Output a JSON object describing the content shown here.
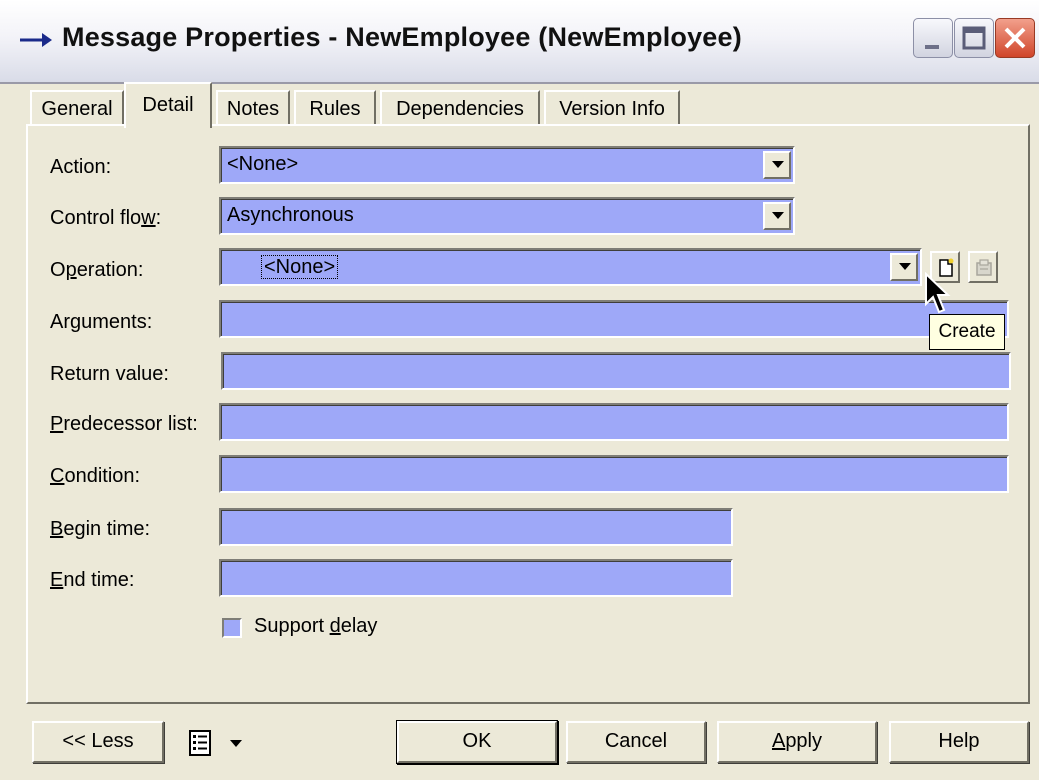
{
  "window": {
    "title": "Message Properties - NewEmployee (NewEmployee)"
  },
  "tabs": [
    {
      "label": "General"
    },
    {
      "label": "Detail"
    },
    {
      "label": "Notes"
    },
    {
      "label": "Rules"
    },
    {
      "label": "Dependencies"
    },
    {
      "label": "Version Info"
    }
  ],
  "form": {
    "action": {
      "label": "Action:",
      "value": "<None>"
    },
    "control_flow": {
      "label_pre": "Control flo",
      "label_u": "w",
      "label_post": ":",
      "value": "Asynchronous"
    },
    "operation": {
      "label_pre": "O",
      "label_u": "p",
      "label_post": "eration:",
      "value": "<None>"
    },
    "arguments": {
      "label": "Arguments:",
      "value": ""
    },
    "return_value": {
      "label": "Return value:",
      "value": ""
    },
    "predecessor_list": {
      "label_u": "P",
      "label_post": "redecessor list:",
      "value": ""
    },
    "condition": {
      "label_u": "C",
      "label_post": "ondition:",
      "value": ""
    },
    "begin_time": {
      "label_u": "B",
      "label_post": "egin time:",
      "value": ""
    },
    "end_time": {
      "label_u": "E",
      "label_post": "nd time:",
      "value": ""
    },
    "support_delay": {
      "label_pre": "Support ",
      "label_u": "d",
      "label_post": "elay",
      "checked": false
    }
  },
  "tooltip": {
    "text": "Create"
  },
  "buttons": {
    "less": "<< Less",
    "ok": "OK",
    "cancel": "Cancel",
    "apply_u": "A",
    "apply_post": "pply",
    "help": "Help"
  },
  "icons": {
    "title": "arrow-right-icon",
    "create": "new-document-icon",
    "properties": "properties-icon",
    "menu": "list-menu-icon"
  },
  "colors": {
    "field_bg": "#9ea8f8",
    "dialog_bg": "#ece9d8",
    "close_red": "#d0452a",
    "tooltip_bg": "#ffffe1"
  }
}
